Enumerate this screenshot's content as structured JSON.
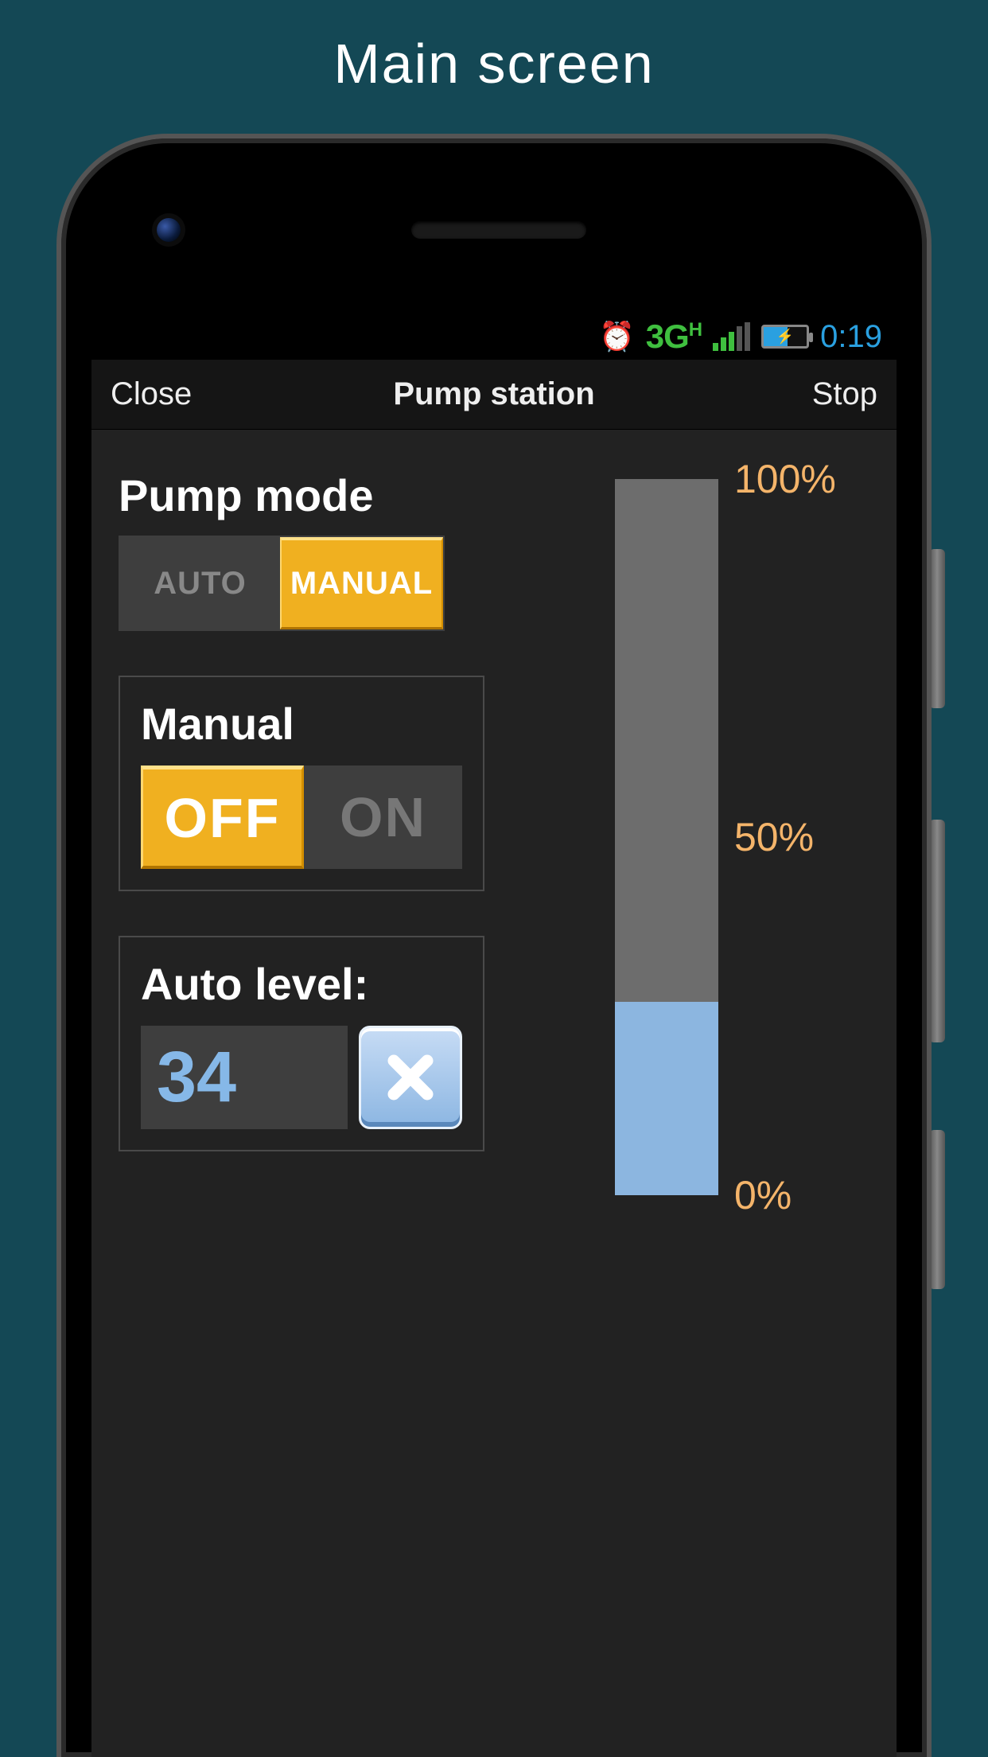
{
  "page": {
    "title": "Main screen"
  },
  "statusbar": {
    "network": "3G",
    "network_sup": "H",
    "time": "0:19"
  },
  "navbar": {
    "left": "Close",
    "title": "Pump station",
    "right": "Stop"
  },
  "pump_mode": {
    "label": "Pump mode",
    "options": {
      "auto": "AUTO",
      "manual": "MANUAL"
    },
    "selected": "manual"
  },
  "manual": {
    "label": "Manual",
    "options": {
      "off": "OFF",
      "on": "ON"
    },
    "selected": "off"
  },
  "auto_level": {
    "label": "Auto level:",
    "value": "34"
  },
  "level_bar": {
    "percent": 27,
    "ticks": {
      "t100": "100%",
      "t50": "50%",
      "t0": "0%"
    }
  }
}
